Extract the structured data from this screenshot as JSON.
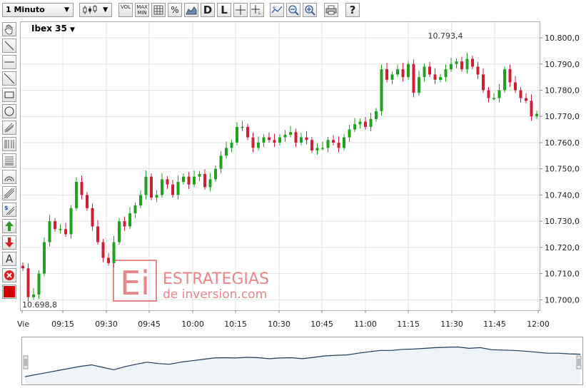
{
  "toolbar": {
    "timeframe": "1 Minuto",
    "chart_style_icon": "candlestick-icon",
    "vol_label": "VOL",
    "max_label": "MAX",
    "min_label": "MIN",
    "grid_icon": "grid-icon",
    "percent_label": "%",
    "d_label": "D",
    "l_label": "L",
    "print_icon": "print-icon",
    "help_label": "?"
  },
  "sidebar": {
    "tools": [
      "hand-icon",
      "trendline-icon",
      "horizontal-line-icon",
      "diagonal-line-icon",
      "rectangle-icon",
      "ellipse-icon",
      "pitchfork-icon",
      "fibonacci-retracement-icon",
      "fibonacci-fan-icon",
      "arc-icon",
      "channel-icon",
      "dollar-channel-icon",
      "arrow-up-icon",
      "arrow-down-icon",
      "text-icon",
      "delete-icon",
      "color-icon"
    ],
    "text_tool_label": "A",
    "dollar_label": "$",
    "arrow_up_color": "#2e9a2e",
    "arrow_down_color": "#d62020",
    "delete_color": "#d62020",
    "color_swatch": "#d40000"
  },
  "watermark": {
    "logo_text": "Ei",
    "line1": "ESTRATEGIAS",
    "line2": "de inversion.com",
    "color": "#e8868a"
  },
  "colors": {
    "up": "#1fa31f",
    "down": "#d01e36",
    "grid": "#e3e3e3",
    "nav_line": "#1f3a5a",
    "nav_fill": "#eef3f8"
  },
  "chart_data": {
    "type": "candlestick",
    "symbol": "Ibex 35",
    "y_ticks": [
      "10.700,0",
      "10.710,0",
      "10.720,0",
      "10.730,0",
      "10.740,0",
      "10.750,0",
      "10.760,0",
      "10.770,0",
      "10.780,0",
      "10.790,0",
      "10.800,0"
    ],
    "ylim": [
      10696,
      10806
    ],
    "x_ticks": [
      "Vie",
      "09:15",
      "09:30",
      "09:45",
      "10:00",
      "10:15",
      "10:30",
      "10:45",
      "11:00",
      "11:15",
      "11:30",
      "11:45",
      "12:00"
    ],
    "max_label": "10.793,4",
    "min_label": "10.698,8",
    "grid": true,
    "closes": [
      10712,
      10701,
      10702,
      10710,
      10722,
      10730,
      10727,
      10727,
      10725,
      10735,
      10745,
      10740,
      10735,
      10728,
      10722,
      10716,
      10714,
      10722,
      10730,
      10728,
      10733,
      10736,
      10740,
      10747,
      10739,
      10740,
      10746,
      10744,
      10740,
      10745,
      10747,
      10744,
      10747,
      10748,
      10743,
      10746,
      10750,
      10755,
      10758,
      10760,
      10766,
      10766,
      10762,
      10758,
      10760,
      10762,
      10761,
      10760,
      10762,
      10763,
      10764,
      10760,
      10762,
      10761,
      10757,
      10758,
      10758,
      10761,
      10760,
      10758,
      10762,
      10765,
      10767,
      10768,
      10766,
      10769,
      10772,
      10788,
      10784,
      10786,
      10788,
      10785,
      10790,
      10779,
      10785,
      10789,
      10786,
      10784,
      10785,
      10788,
      10790,
      10791,
      10788,
      10792,
      10789,
      10786,
      10780,
      10777,
      10777,
      10780,
      10788,
      10783,
      10780,
      10777,
      10776,
      10770,
      10771
    ],
    "x_range": [
      "09:01",
      "12:00"
    ],
    "nav_closes": [
      10706,
      10712,
      10718,
      10724,
      10730,
      10736,
      10740,
      10733,
      10726,
      10735,
      10742,
      10748,
      10744,
      10742,
      10748,
      10752,
      10756,
      10760,
      10761,
      10760,
      10762,
      10761,
      10758,
      10760,
      10761,
      10758,
      10762,
      10766,
      10768,
      10769,
      10774,
      10778,
      10782,
      10782,
      10785,
      10786,
      10788,
      10790,
      10791,
      10792,
      10788,
      10790,
      10784,
      10783,
      10782,
      10780,
      10777,
      10774,
      10774,
      10772,
      10771
    ]
  }
}
